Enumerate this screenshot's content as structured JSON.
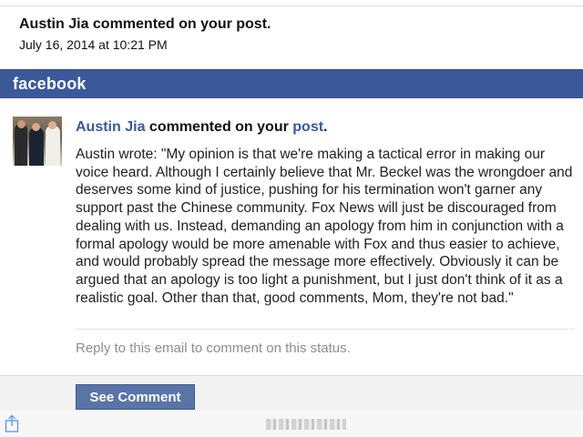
{
  "mail": {
    "subject": "Austin Jia commented on your post.",
    "date": "July 16, 2014 at 10:21 PM"
  },
  "facebook_bar": {
    "logo_text": "facebook",
    "color": "#3b5998"
  },
  "notification": {
    "actor": "Austin Jia",
    "action": " commented on your ",
    "object": "post",
    "end": ".",
    "message": "Austin wrote: \"My opinion is that we're making a tactical error in making our voice heard. Although I certainly believe that Mr. Beckel was the wrongdoer and deserves some kind of justice, pushing for his termination won't garner any support past the Chinese community. Fox News will just be discouraged from dealing with us. Instead, demanding an apology from him in conjunction with a formal apology would be more amenable with Fox and thus easier to achieve, and would probably spread the message more effectively. Obviously it can be argued that an apology is too light a punishment, but I just don't think of it as a realistic goal. Other than that, good comments, Mom, they're not bad.\"",
    "reply_note": "Reply to this email to comment on this status."
  },
  "actions": {
    "see_comment_label": "See Comment"
  },
  "icons": {
    "share": "share-icon",
    "avatar": "avatar"
  }
}
